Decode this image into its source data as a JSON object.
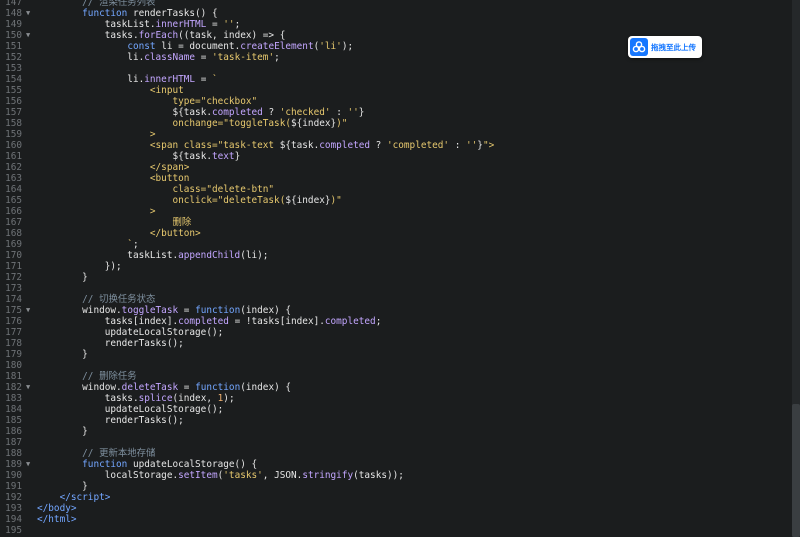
{
  "upload_button": {
    "label": "拖拽至此上传",
    "icon": "cloud-upload-icon",
    "accent": "#1677ff"
  },
  "lines": [
    {
      "n": "147",
      "fold": false,
      "html": "        <span class=\"cm\">// 渲染任务列表</span>"
    },
    {
      "n": "148",
      "fold": true,
      "html": "        <span class=\"kw\">function</span> renderTasks() {"
    },
    {
      "n": "149",
      "fold": false,
      "html": "            taskList.<span class=\"prop\">innerHTML</span> = <span class=\"str\">''</span>;"
    },
    {
      "n": "150",
      "fold": true,
      "html": "            tasks.<span class=\"prop\">forEach</span>((task, index) => {"
    },
    {
      "n": "151",
      "fold": false,
      "html": "                <span class=\"kw\">const</span> li = document.<span class=\"prop\">createElement</span>(<span class=\"str\">'li'</span>);"
    },
    {
      "n": "152",
      "fold": false,
      "html": "                li.<span class=\"prop\">className</span> = <span class=\"str\">'task-item'</span>;"
    },
    {
      "n": "153",
      "fold": false,
      "html": ""
    },
    {
      "n": "154",
      "fold": false,
      "html": "                li.<span class=\"prop\">innerHTML</span> = <span class=\"str\">`</span>"
    },
    {
      "n": "155",
      "fold": false,
      "html": "<span class=\"str\">                    &lt;input</span>"
    },
    {
      "n": "156",
      "fold": false,
      "html": "<span class=\"str\">                        type=\"checkbox\"</span>"
    },
    {
      "n": "157",
      "fold": false,
      "html": "<span class=\"str\">                        </span>${task.<span class=\"prop\">completed</span> ? <span class=\"str\">'checked'</span> : <span class=\"str\">''</span>}"
    },
    {
      "n": "158",
      "fold": false,
      "html": "<span class=\"str\">                        onchange=\"toggleTask(</span>${index}<span class=\"str\">)\"</span>"
    },
    {
      "n": "159",
      "fold": false,
      "html": "<span class=\"str\">                    &gt;</span>"
    },
    {
      "n": "160",
      "fold": false,
      "html": "<span class=\"str\">                    &lt;span class=\"task-text </span>${task.<span class=\"prop\">completed</span> ? <span class=\"str\">'completed'</span> : <span class=\"str\">''</span>}<span class=\"str\">\"&gt;</span>"
    },
    {
      "n": "161",
      "fold": false,
      "html": "<span class=\"str\">                        </span>${task.<span class=\"prop\">text</span>}"
    },
    {
      "n": "162",
      "fold": false,
      "html": "<span class=\"str\">                    &lt;/span&gt;</span>"
    },
    {
      "n": "163",
      "fold": false,
      "html": "<span class=\"str\">                    &lt;button</span>"
    },
    {
      "n": "164",
      "fold": false,
      "html": "<span class=\"str\">                        class=\"delete-btn\"</span>"
    },
    {
      "n": "165",
      "fold": false,
      "html": "<span class=\"str\">                        onclick=\"deleteTask(</span>${index}<span class=\"str\">)\"</span>"
    },
    {
      "n": "166",
      "fold": false,
      "html": "<span class=\"str\">                    &gt;</span>"
    },
    {
      "n": "167",
      "fold": false,
      "html": "<span class=\"str\">                        删除</span>"
    },
    {
      "n": "168",
      "fold": false,
      "html": "<span class=\"str\">                    &lt;/button&gt;</span>"
    },
    {
      "n": "169",
      "fold": false,
      "html": "<span class=\"str\">                `</span>;"
    },
    {
      "n": "170",
      "fold": false,
      "html": "                taskList.<span class=\"prop\">appendChild</span>(li);"
    },
    {
      "n": "171",
      "fold": false,
      "html": "            });"
    },
    {
      "n": "172",
      "fold": false,
      "html": "        }"
    },
    {
      "n": "173",
      "fold": false,
      "html": ""
    },
    {
      "n": "174",
      "fold": false,
      "html": "        <span class=\"cm\">// 切换任务状态</span>"
    },
    {
      "n": "175",
      "fold": true,
      "html": "        window.<span class=\"prop\">toggleTask</span> = <span class=\"kw\">function</span>(index) {"
    },
    {
      "n": "176",
      "fold": false,
      "html": "            tasks[index].<span class=\"prop\">completed</span> = !tasks[index].<span class=\"prop\">completed</span>;"
    },
    {
      "n": "177",
      "fold": false,
      "html": "            updateLocalStorage();"
    },
    {
      "n": "178",
      "fold": false,
      "html": "            renderTasks();"
    },
    {
      "n": "179",
      "fold": false,
      "html": "        }"
    },
    {
      "n": "180",
      "fold": false,
      "html": ""
    },
    {
      "n": "181",
      "fold": false,
      "html": "        <span class=\"cm\">// 删除任务</span>"
    },
    {
      "n": "182",
      "fold": true,
      "html": "        window.<span class=\"prop\">deleteTask</span> = <span class=\"kw\">function</span>(index) {"
    },
    {
      "n": "183",
      "fold": false,
      "html": "            tasks.<span class=\"prop\">splice</span>(index, <span class=\"num\">1</span>);"
    },
    {
      "n": "184",
      "fold": false,
      "html": "            updateLocalStorage();"
    },
    {
      "n": "185",
      "fold": false,
      "html": "            renderTasks();"
    },
    {
      "n": "186",
      "fold": false,
      "html": "        }"
    },
    {
      "n": "187",
      "fold": false,
      "html": ""
    },
    {
      "n": "188",
      "fold": false,
      "html": "        <span class=\"cm\">// 更新本地存储</span>"
    },
    {
      "n": "189",
      "fold": true,
      "html": "        <span class=\"kw\">function</span> updateLocalStorage() {"
    },
    {
      "n": "190",
      "fold": false,
      "html": "            localStorage.<span class=\"prop\">setItem</span>(<span class=\"str\">'tasks'</span>, JSON.<span class=\"prop\">stringify</span>(tasks));"
    },
    {
      "n": "191",
      "fold": false,
      "html": "        }"
    },
    {
      "n": "192",
      "fold": false,
      "html": "    <span class=\"kw\">&lt;/script&gt;</span>"
    },
    {
      "n": "193",
      "fold": false,
      "html": "<span class=\"kw\">&lt;/body&gt;</span>"
    },
    {
      "n": "194",
      "fold": false,
      "html": "<span class=\"kw\">&lt;/html&gt;</span>"
    },
    {
      "n": "195",
      "fold": false,
      "html": ""
    }
  ]
}
